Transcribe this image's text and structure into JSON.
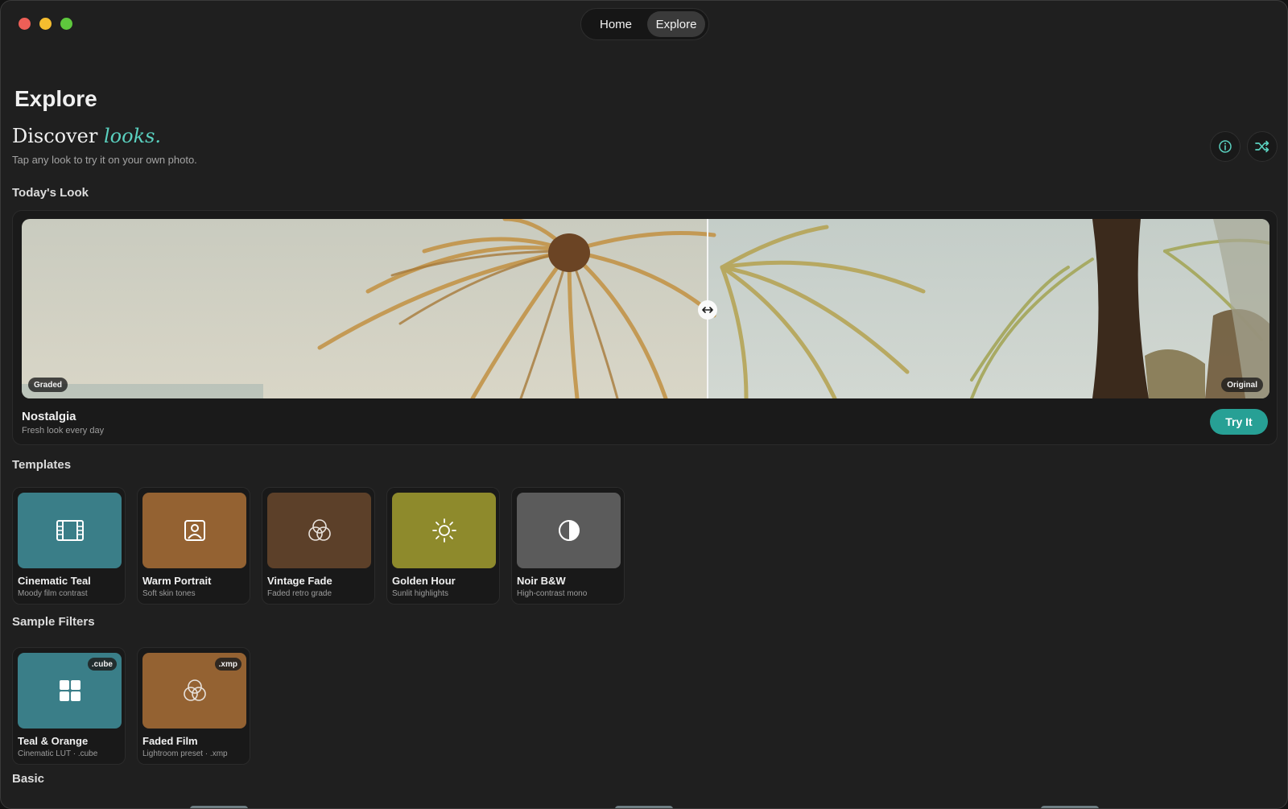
{
  "nav": {
    "tabs": [
      {
        "label": "Home",
        "active": false
      },
      {
        "label": "Explore",
        "active": true
      }
    ]
  },
  "header": {
    "title": "Explore",
    "discover_prefix": "Discover",
    "discover_accent": "looks.",
    "subtitle": "Tap any look to try it on your own photo.",
    "info_icon": "info-icon",
    "shuffle_icon": "shuffle-icon"
  },
  "todays_look": {
    "section_label": "Today's Look",
    "left_badge": "Graded",
    "right_badge": "Original",
    "name": "Nostalgia",
    "description": "Fresh look every day",
    "cta": "Try It",
    "comparison_split": 0.55
  },
  "templates": {
    "section_label": "Templates",
    "items": [
      {
        "title": "Cinematic Teal",
        "subtitle": "Moody film contrast",
        "color": "#3a7e88",
        "icon": "film-icon"
      },
      {
        "title": "Warm Portrait",
        "subtitle": "Soft skin tones",
        "color": "#946232",
        "icon": "portrait-icon"
      },
      {
        "title": "Vintage Fade",
        "subtitle": "Faded retro grade",
        "color": "#5c4029",
        "icon": "color-circles-icon"
      },
      {
        "title": "Golden Hour",
        "subtitle": "Sunlit highlights",
        "color": "#8e8a2c",
        "icon": "sun-icon"
      },
      {
        "title": "Noir B&W",
        "subtitle": "High-contrast mono",
        "color": "#5b5b5b",
        "icon": "half-circle-icon"
      }
    ]
  },
  "sample_filters": {
    "section_label": "Sample Filters",
    "items": [
      {
        "title": "Teal & Orange",
        "subtitle": "Cinematic LUT · .cube",
        "badge": ".cube",
        "color": "#3a7e88",
        "icon": "grid-icon"
      },
      {
        "title": "Faded Film",
        "subtitle": "Lightroom preset · .xmp",
        "badge": ".xmp",
        "color": "#946232",
        "icon": "color-circles-icon"
      }
    ]
  },
  "basic": {
    "section_label": "Basic"
  },
  "colors": {
    "accent": "#27a095",
    "accent_text": "#5ad0bf",
    "background": "#1f1f1f"
  }
}
